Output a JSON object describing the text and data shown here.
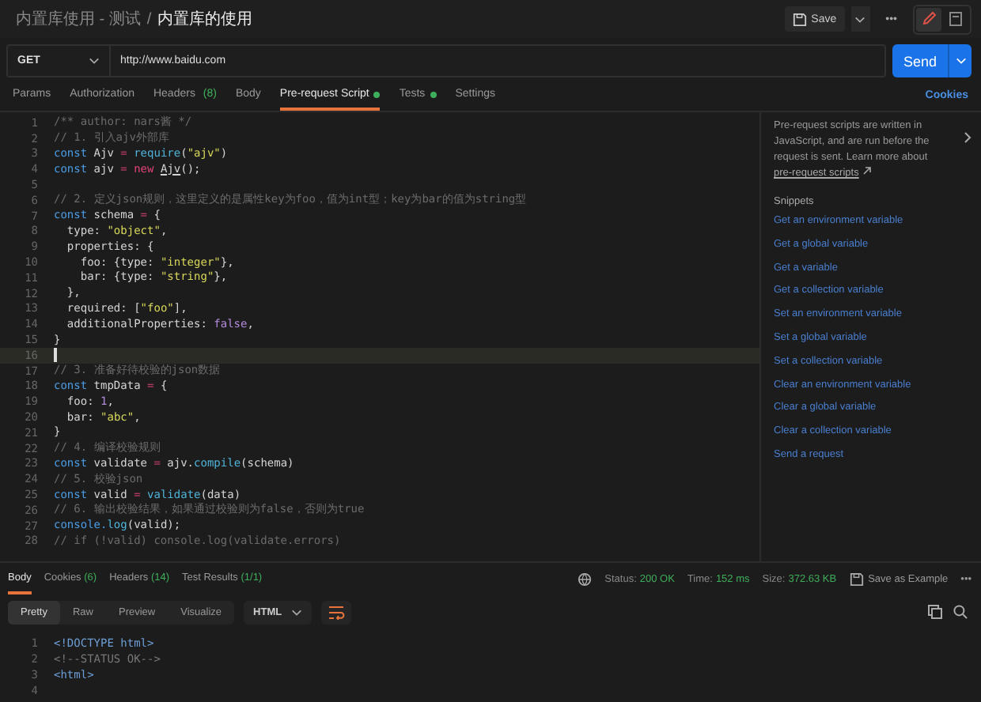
{
  "breadcrumb": {
    "parent": "内置库使用 - 测试",
    "separator": "/",
    "current": "内置库的使用"
  },
  "header_actions": {
    "save": "Save",
    "more": "•••",
    "edit_selected": true
  },
  "request": {
    "method": "GET",
    "url": "http://www.baidu.com",
    "send": "Send"
  },
  "tabs": [
    {
      "label": "Params",
      "dot": false,
      "selected": false
    },
    {
      "label": "Authorization",
      "dot": false,
      "selected": false
    },
    {
      "label": "Headers",
      "count": "(8)",
      "dot": false,
      "selected": false
    },
    {
      "label": "Body",
      "dot": false,
      "selected": false
    },
    {
      "label": "Pre-request Script",
      "dot": true,
      "selected": true
    },
    {
      "label": "Tests",
      "dot": true,
      "selected": false
    },
    {
      "label": "Settings",
      "dot": false,
      "selected": false
    }
  ],
  "cookies_link": "Cookies",
  "editor": {
    "lines": [
      {
        "n": "1",
        "current": false,
        "tokens": [
          {
            "kind": "comment",
            "text": "/** author: nars酱 */"
          }
        ]
      },
      {
        "n": "2",
        "current": false,
        "tokens": [
          {
            "kind": "comment",
            "text": "// 1. 引入ajv外部库"
          }
        ]
      },
      {
        "n": "3",
        "current": false,
        "tokens": [
          {
            "kind": "keyword",
            "text": "const"
          },
          {
            "kind": "plain",
            "text": " Ajv "
          },
          {
            "kind": "operator",
            "text": "= "
          },
          {
            "kind": "function",
            "text": "require"
          },
          {
            "kind": "plain",
            "text": "("
          },
          {
            "kind": "string",
            "text": "\"ajv\""
          },
          {
            "kind": "plain",
            "text": ")"
          }
        ]
      },
      {
        "n": "4",
        "current": false,
        "tokens": [
          {
            "kind": "keyword",
            "text": "const"
          },
          {
            "kind": "plain",
            "text": " ajv "
          },
          {
            "kind": "operator",
            "text": "= new "
          },
          {
            "kind": "class",
            "text": "Ajv"
          },
          {
            "kind": "plain",
            "text": "();"
          }
        ]
      },
      {
        "n": "5",
        "current": false
      },
      {
        "n": "6",
        "current": false,
        "tokens": [
          {
            "kind": "comment",
            "text": "// 2. 定义json规则，这里定义的是属性key为foo，值为int型；key为bar的值为string型"
          }
        ]
      },
      {
        "n": "7",
        "current": false,
        "tokens": [
          {
            "kind": "keyword",
            "text": "const"
          },
          {
            "kind": "plain",
            "text": " schema "
          },
          {
            "kind": "operator",
            "text": "="
          },
          {
            "kind": "plain",
            "text": " {"
          }
        ]
      },
      {
        "n": "8",
        "current": false,
        "tokens": [
          {
            "kind": "plain",
            "text": "  type: "
          },
          {
            "kind": "string",
            "text": "\"object\""
          },
          {
            "kind": "plain",
            "text": ","
          }
        ]
      },
      {
        "n": "9",
        "current": false,
        "tokens": [
          {
            "kind": "plain",
            "text": "  properties: {"
          }
        ]
      },
      {
        "n": "10",
        "current": false,
        "tokens": [
          {
            "kind": "plain",
            "text": "    foo: {type: "
          },
          {
            "kind": "string",
            "text": "\"integer\""
          },
          {
            "kind": "plain",
            "text": "},"
          }
        ]
      },
      {
        "n": "11",
        "current": false,
        "tokens": [
          {
            "kind": "plain",
            "text": "    bar: {type: "
          },
          {
            "kind": "string",
            "text": "\"string\""
          },
          {
            "kind": "plain",
            "text": "},"
          }
        ]
      },
      {
        "n": "12",
        "current": false,
        "tokens": [
          {
            "kind": "plain",
            "text": "  },"
          }
        ]
      },
      {
        "n": "13",
        "current": false,
        "tokens": [
          {
            "kind": "plain",
            "text": "  required: ["
          },
          {
            "kind": "string",
            "text": "\"foo\""
          },
          {
            "kind": "plain",
            "text": "],"
          }
        ]
      },
      {
        "n": "14",
        "current": false,
        "tokens": [
          {
            "kind": "plain",
            "text": "  additionalProperties: "
          },
          {
            "kind": "literal",
            "text": "false"
          },
          {
            "kind": "plain",
            "text": ","
          }
        ]
      },
      {
        "n": "15",
        "current": false,
        "tokens": [
          {
            "kind": "plain",
            "text": "}"
          }
        ]
      },
      {
        "n": "16",
        "current": true
      },
      {
        "n": "17",
        "current": false,
        "tokens": [
          {
            "kind": "comment",
            "text": "// 3. 准备好待校验的json数据"
          }
        ]
      },
      {
        "n": "18",
        "current": false,
        "tokens": [
          {
            "kind": "keyword",
            "text": "const"
          },
          {
            "kind": "plain",
            "text": " tmpData "
          },
          {
            "kind": "operator",
            "text": "="
          },
          {
            "kind": "plain",
            "text": " {"
          }
        ]
      },
      {
        "n": "19",
        "current": false,
        "tokens": [
          {
            "kind": "plain",
            "text": "  foo: "
          },
          {
            "kind": "literal",
            "text": "1"
          },
          {
            "kind": "plain",
            "text": ","
          }
        ]
      },
      {
        "n": "20",
        "current": false,
        "tokens": [
          {
            "kind": "plain",
            "text": "  bar: "
          },
          {
            "kind": "string",
            "text": "\"abc\""
          },
          {
            "kind": "plain",
            "text": ","
          }
        ]
      },
      {
        "n": "21",
        "current": false,
        "tokens": [
          {
            "kind": "plain",
            "text": "}"
          }
        ]
      },
      {
        "n": "22",
        "current": false,
        "tokens": [
          {
            "kind": "comment",
            "text": "// 4. 编译校验规则"
          }
        ]
      },
      {
        "n": "23",
        "current": false,
        "tokens": [
          {
            "kind": "keyword",
            "text": "const"
          },
          {
            "kind": "plain",
            "text": " validate "
          },
          {
            "kind": "operator",
            "text": "="
          },
          {
            "kind": "plain",
            "text": " ajv."
          },
          {
            "kind": "function",
            "text": "compile"
          },
          {
            "kind": "plain",
            "text": "(schema)"
          }
        ]
      },
      {
        "n": "24",
        "current": false,
        "tokens": [
          {
            "kind": "comment",
            "text": "// 5. 校验json"
          }
        ]
      },
      {
        "n": "25",
        "current": false,
        "tokens": [
          {
            "kind": "keyword",
            "text": "const"
          },
          {
            "kind": "plain",
            "text": " valid "
          },
          {
            "kind": "operator",
            "text": "= "
          },
          {
            "kind": "function",
            "text": "validate"
          },
          {
            "kind": "plain",
            "text": "(data)"
          }
        ]
      },
      {
        "n": "26",
        "current": false,
        "tokens": [
          {
            "kind": "comment",
            "text": "// 6. 输出校验结果，如果通过校验则为false，否则为true"
          }
        ]
      },
      {
        "n": "27",
        "current": false,
        "tokens": [
          {
            "kind": "keyword",
            "text": "console."
          },
          {
            "kind": "function",
            "text": "log"
          },
          {
            "kind": "plain",
            "text": "(valid);"
          }
        ]
      },
      {
        "n": "28",
        "current": false,
        "tokens": [
          {
            "kind": "comment",
            "text": "// if (!valid) console.log(validate.errors)"
          }
        ]
      }
    ]
  },
  "sidebar": {
    "description": "Pre-request scripts are written in JavaScript, and are run before the request is sent. Learn more about",
    "link": "pre-request scripts",
    "heading": "Snippets",
    "snippets": [
      "Get an environment variable",
      "Get a global variable",
      "Get a variable",
      "Get a collection variable",
      "Set an environment variable",
      "Set a global variable",
      "Set a collection variable",
      "Clear an environment variable",
      "Clear a global variable",
      "Clear a collection variable",
      "Send a request"
    ]
  },
  "response": {
    "tabs": [
      {
        "label": "Body",
        "selected": true
      },
      {
        "label": "Cookies",
        "count": "(6)",
        "selected": false
      },
      {
        "label": "Headers",
        "count": "(14)",
        "selected": false
      },
      {
        "label": "Test Results",
        "count": "(1/1)",
        "selected": false
      }
    ],
    "status_label": "Status:",
    "status": "200 OK",
    "time_label": "Time:",
    "time": "152 ms",
    "size_label": "Size:",
    "size": "372.63 KB",
    "save_example": "Save as Example",
    "more": "•••",
    "views": [
      {
        "label": "Pretty",
        "selected": true
      },
      {
        "label": "Raw",
        "selected": false
      },
      {
        "label": "Preview",
        "selected": false
      },
      {
        "label": "Visualize",
        "selected": false
      }
    ],
    "format": "HTML",
    "lines": [
      {
        "n": "1",
        "kind": "tag",
        "text": "<!DOCTYPE html>"
      },
      {
        "n": "2",
        "kind": "comment",
        "text": "<!--STATUS OK-->"
      },
      {
        "n": "3",
        "kind": "tag",
        "text": "<html>"
      },
      {
        "n": "4"
      }
    ]
  }
}
